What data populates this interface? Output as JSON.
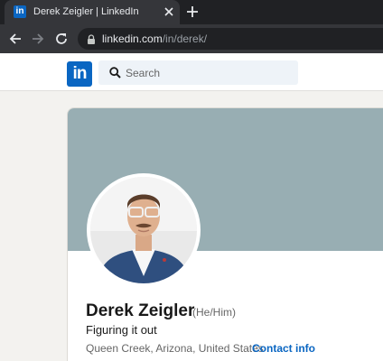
{
  "browser": {
    "tab": {
      "favicon": "linkedin-favicon",
      "title": "Derek Zeigler | LinkedIn"
    },
    "url": {
      "host": "linkedin.com",
      "path": "/in/derek/"
    }
  },
  "nav": {
    "logo_text": "in",
    "search_placeholder": "Search"
  },
  "profile": {
    "name": "Derek Zeigler",
    "pronouns": "(He/Him)",
    "headline": "Figuring it out",
    "location": "Queen Creek, Arizona, United States",
    "separator": "·",
    "contact_label": "Contact info"
  },
  "colors": {
    "linkedin_blue": "#0a66c2",
    "banner": "#98aeb3",
    "page_background": "#f3f2ef"
  }
}
